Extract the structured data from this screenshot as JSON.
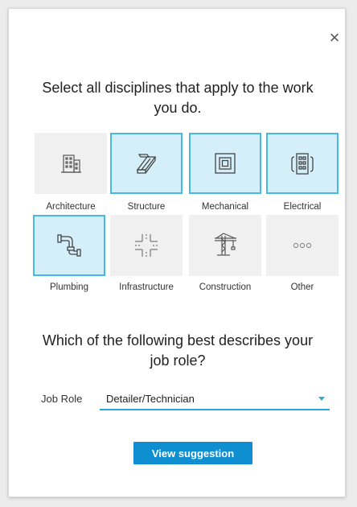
{
  "dialog": {
    "close_symbol": "×",
    "disciplines_heading": "Select all disciplines that apply to the work you do.",
    "job_heading": "Which of the following best describes your job role?",
    "job_role_label": "Job Role",
    "job_role_value": "Detailer/Technician",
    "submit_label": "View suggestion"
  },
  "disciplines": [
    {
      "label": "Architecture",
      "icon": "building-icon",
      "selected": false
    },
    {
      "label": "Structure",
      "icon": "steel-beam-icon",
      "selected": true
    },
    {
      "label": "Mechanical",
      "icon": "duct-icon",
      "selected": true
    },
    {
      "label": "Electrical",
      "icon": "electrical-panel-icon",
      "selected": true
    },
    {
      "label": "Plumbing",
      "icon": "pipe-icon",
      "selected": true
    },
    {
      "label": "Infrastructure",
      "icon": "road-intersection-icon",
      "selected": false
    },
    {
      "label": "Construction",
      "icon": "crane-icon",
      "selected": false
    },
    {
      "label": "Other",
      "icon": "more-icon",
      "selected": false
    }
  ],
  "colors": {
    "accent": "#2aa7df",
    "selected_bg": "#d4eff9",
    "button": "#0f8fd1"
  }
}
